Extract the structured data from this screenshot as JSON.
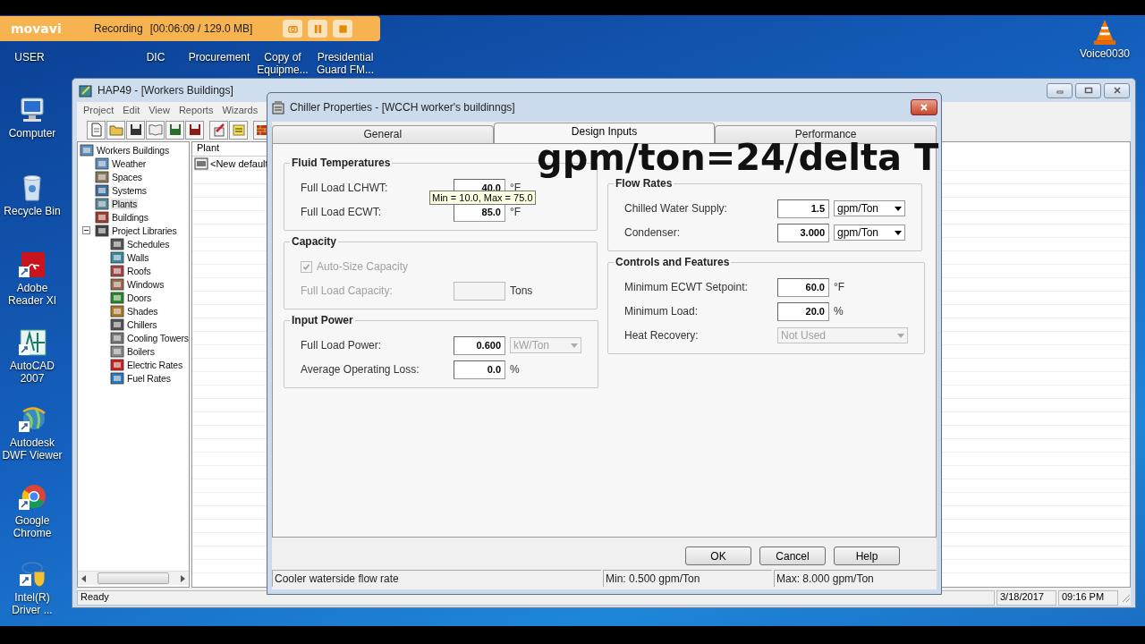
{
  "recorder": {
    "logo": "movavi",
    "status": "Recording",
    "info": "[00:06:09 / 129.0 MB]"
  },
  "desktop": {
    "top_icons": [
      {
        "label": "USER"
      },
      {
        "label": "DIC"
      },
      {
        "label": "Procurement"
      },
      {
        "label": "Copy of Equipme..."
      },
      {
        "label": "Presidential Guard FM..."
      },
      {
        "label": "Voice0030"
      }
    ],
    "left_icons": [
      {
        "label": "Computer"
      },
      {
        "label": "Recycle Bin"
      },
      {
        "label": "Adobe Reader XI"
      },
      {
        "label": "AutoCAD 2007"
      },
      {
        "label": "Autodesk DWF Viewer"
      },
      {
        "label": "Google Chrome"
      },
      {
        "label": "Intel(R) Driver ..."
      }
    ]
  },
  "main_window": {
    "title": "HAP49 - [Workers Buildings]",
    "menu": [
      "Project",
      "Edit",
      "View",
      "Reports",
      "Wizards"
    ],
    "tree": [
      {
        "label": "Workers Buildings",
        "selected": false,
        "children": [
          {
            "label": "Weather",
            "selected": false
          },
          {
            "label": "Spaces",
            "selected": false
          },
          {
            "label": "Systems",
            "selected": false
          },
          {
            "label": "Plants",
            "selected": true
          },
          {
            "label": "Buildings",
            "selected": false
          },
          {
            "label": "Project Libraries",
            "selected": false,
            "expanded": true,
            "children": [
              {
                "label": "Schedules",
                "selected": false
              },
              {
                "label": "Walls",
                "selected": false
              },
              {
                "label": "Roofs",
                "selected": false
              },
              {
                "label": "Windows",
                "selected": false
              },
              {
                "label": "Doors",
                "selected": false
              },
              {
                "label": "Shades",
                "selected": false
              },
              {
                "label": "Chillers",
                "selected": false
              },
              {
                "label": "Cooling Towers",
                "selected": false
              },
              {
                "label": "Boilers",
                "selected": false
              },
              {
                "label": "Electric Rates",
                "selected": false
              },
              {
                "label": "Fuel Rates",
                "selected": false
              }
            ]
          }
        ]
      }
    ],
    "list": {
      "column": "Plant",
      "rows": [
        {
          "label": "<New default"
        }
      ]
    },
    "status": [
      "Ready",
      "3/18/2017",
      "09:16 PM"
    ]
  },
  "dialog": {
    "title": "Chiller Properties  - [WCCH worker's buildinngs]",
    "tabs": [
      {
        "label": "General",
        "selected": false
      },
      {
        "label": "Design Inputs",
        "selected": true
      },
      {
        "label": "Performance",
        "selected": false
      }
    ],
    "groups_left": [
      {
        "title": "Fluid Temperatures",
        "disabled": false,
        "rows": [
          {
            "kind": "input",
            "label": "Full Load LCHWT:",
            "value": "40.0",
            "unit": "°F"
          },
          {
            "kind": "input",
            "label": "Full Load ECWT:",
            "value": "85.0",
            "unit": "°F"
          }
        ]
      },
      {
        "title": "Capacity",
        "disabled": true,
        "rows": [
          {
            "kind": "checkbox",
            "label": "Auto-Size Capacity",
            "checked": true
          },
          {
            "kind": "input",
            "label": "Full Load Capacity:",
            "unit": "Tons"
          }
        ]
      },
      {
        "title": "Input Power",
        "disabled": false,
        "rows": [
          {
            "kind": "input",
            "label": "Full Load Power:",
            "value": "0.600",
            "select": {
              "value": "kW/Ton",
              "disabled": true
            }
          },
          {
            "kind": "input",
            "label": "Average Operating Loss:",
            "value": "0.0",
            "unit": "%"
          }
        ]
      }
    ],
    "groups_right": [
      {
        "title": "Flow Rates",
        "disabled": false,
        "rows": [
          {
            "kind": "input",
            "label": "Chilled Water Supply:",
            "value": "1.5",
            "select": {
              "value": "gpm/Ton",
              "disabled": false
            }
          },
          {
            "kind": "input",
            "label": "Condenser:",
            "value": "3.000",
            "select": {
              "value": "gpm/Ton",
              "disabled": false
            }
          }
        ]
      },
      {
        "title": "Controls and Features",
        "disabled": false,
        "rows": [
          {
            "kind": "input",
            "label": "Minimum ECWT Setpoint:",
            "value": "60.0",
            "unit": "°F"
          },
          {
            "kind": "input",
            "label": "Minimum Load:",
            "value": "20.0",
            "unit": "%"
          },
          {
            "kind": "select",
            "label": "Heat Recovery:",
            "value": "Not Used",
            "disabled": true
          }
        ]
      }
    ],
    "tooltip": "Min = 10.0, Max = 75.0",
    "buttons": [
      "OK",
      "Cancel",
      "Help"
    ],
    "status": [
      "Cooler waterside flow rate",
      "Min: 0.500 gpm/Ton",
      "Max: 8.000 gpm/Ton"
    ]
  },
  "annotation": {
    "text": "gpm/ton=24/delta T"
  }
}
